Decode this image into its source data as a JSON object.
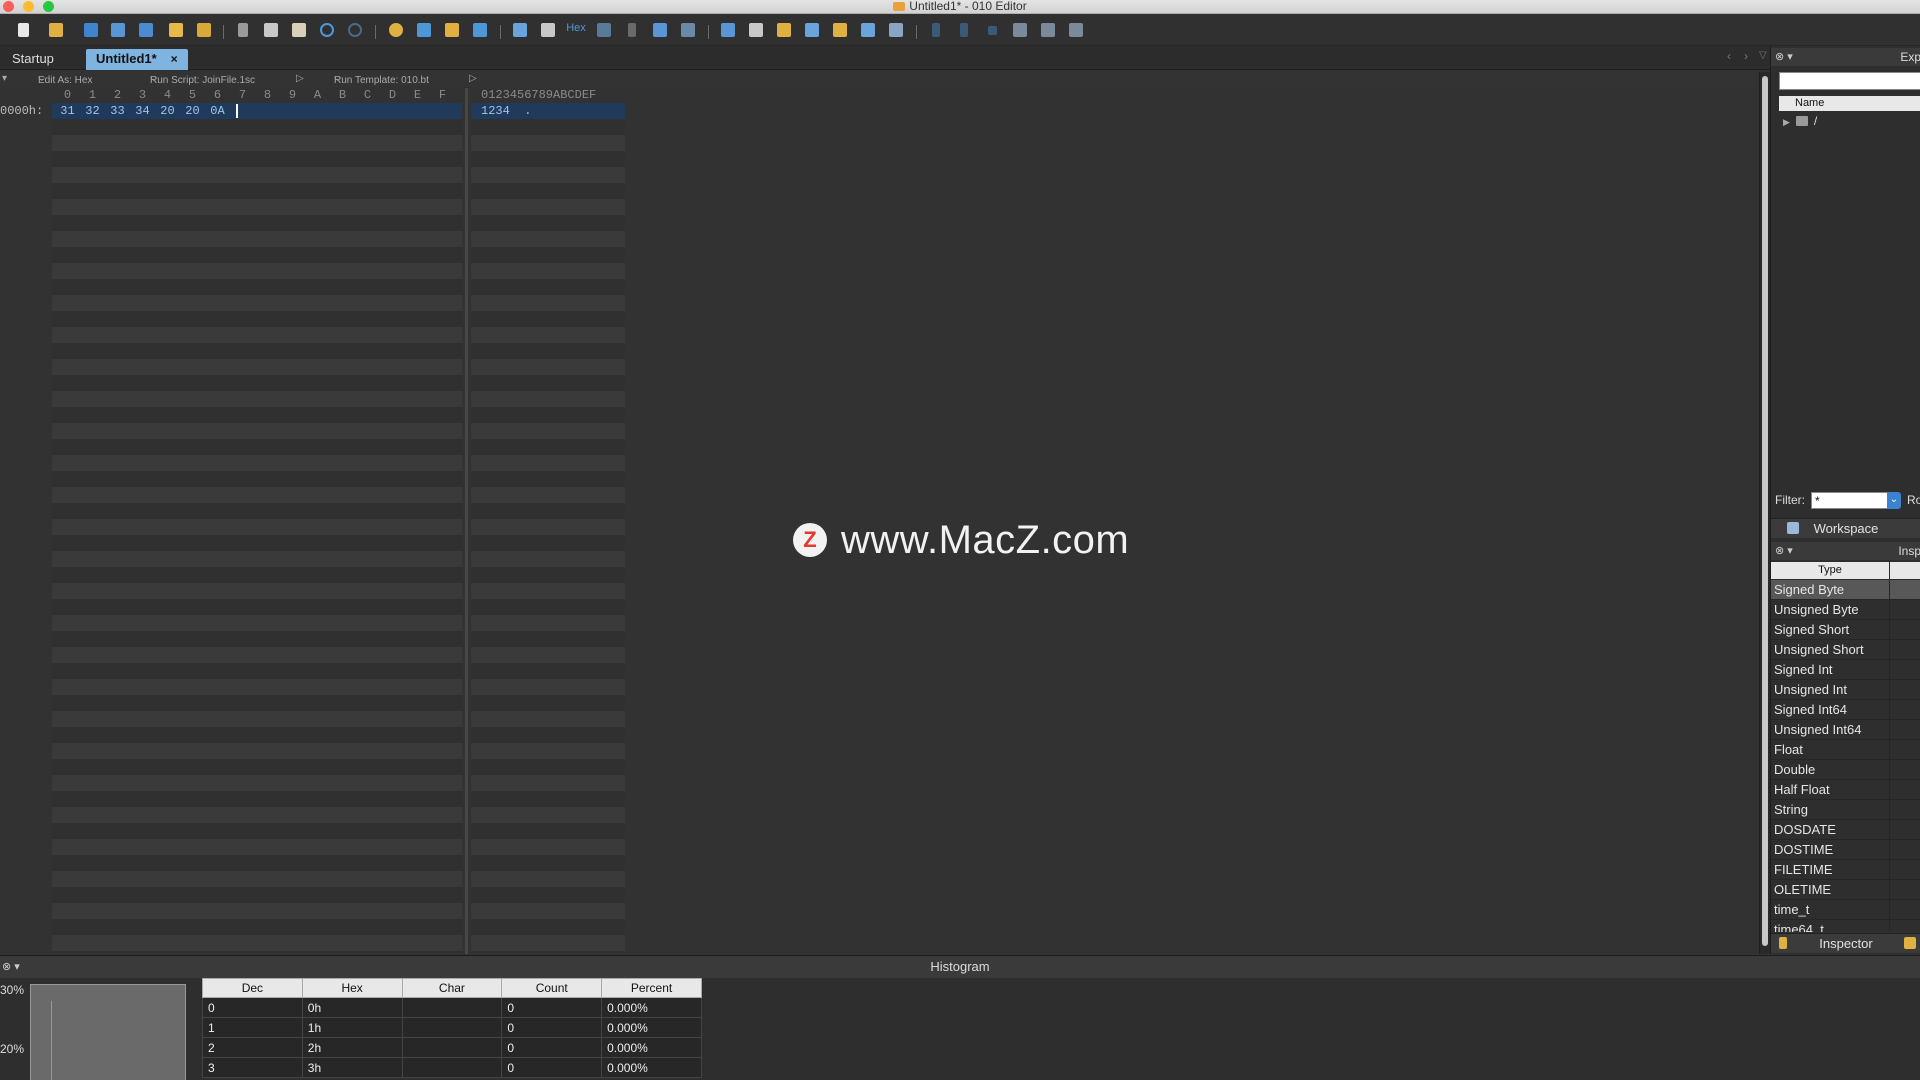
{
  "window": {
    "title": "Untitled1* - 010 Editor"
  },
  "toolbar": {
    "hex_label": "Hex"
  },
  "tabs": [
    {
      "label": "Startup",
      "active": false
    },
    {
      "label": "Untitled1*",
      "active": true,
      "close": "×"
    }
  ],
  "editbar": {
    "edit_as": "Edit As: Hex",
    "run_script": "Run Script: JoinFile.1sc",
    "run_template": "Run Template: 010.bt"
  },
  "editor": {
    "ruler": [
      "0",
      "1",
      "2",
      "3",
      "4",
      "5",
      "6",
      "7",
      "8",
      "9",
      "A",
      "B",
      "C",
      "D",
      "E",
      "F"
    ],
    "text_ruler": "0123456789ABCDEF",
    "row_address": "0000h:",
    "bytes": [
      "31",
      "32",
      "33",
      "34",
      "20",
      "20",
      "0A"
    ],
    "text_line": "1234  ."
  },
  "watermark": {
    "logo_letter": "Z",
    "text": "www.MacZ.com"
  },
  "explorer": {
    "title": "Exp",
    "column_name": "Name",
    "root": "/",
    "filter_label": "Filter:",
    "filter_value": "*",
    "filter_extra": "Ro",
    "tab_label": "Workspace"
  },
  "inspector": {
    "title": "Insp",
    "column_type": "Type",
    "tab_label": "Inspector",
    "types": [
      "Signed Byte",
      "Unsigned Byte",
      "Signed Short",
      "Unsigned Short",
      "Signed Int",
      "Unsigned Int",
      "Signed Int64",
      "Unsigned Int64",
      "Float",
      "Double",
      "Half Float",
      "String",
      "DOSDATE",
      "DOSTIME",
      "FILETIME",
      "OLETIME",
      "time_t",
      "time64_t"
    ],
    "selected_index": 0
  },
  "histogram": {
    "title": "Histogram",
    "y_labels": [
      "30%",
      "20%"
    ],
    "columns": [
      "Dec",
      "Hex",
      "Char",
      "Count",
      "Percent"
    ],
    "rows": [
      [
        "0",
        "0h",
        "",
        "0",
        "0.000%"
      ],
      [
        "1",
        "1h",
        "",
        "0",
        "0.000%"
      ],
      [
        "2",
        "2h",
        "",
        "0",
        "0.000%"
      ],
      [
        "3",
        "3h",
        "",
        "0",
        "0.000%"
      ]
    ]
  },
  "colors": {
    "accent": "#7fb4e0",
    "selection": "#1f3a5a",
    "hex_text": "#9fc5ef"
  }
}
